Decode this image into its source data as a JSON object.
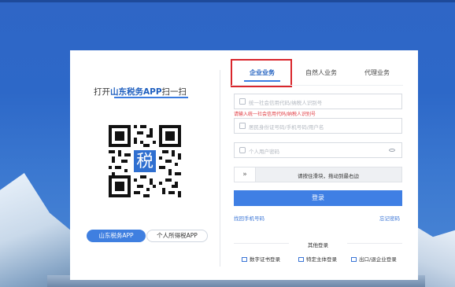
{
  "left_panel": {
    "title_prefix": "打开",
    "title_highlight": "山东税务APP",
    "title_suffix": "扫一扫",
    "qr_center_char": "税",
    "app_button_primary": "山东税务APP",
    "app_button_secondary": "个人所得税APP"
  },
  "tabs": [
    {
      "label": "企业业务",
      "active": true
    },
    {
      "label": "自然人业务",
      "active": false
    },
    {
      "label": "代理业务",
      "active": false
    }
  ],
  "form": {
    "credit_code_placeholder": "统一社会信用代码/纳税人识别号",
    "credit_code_error": "请输入统一社会信用代码/纳税人识别号",
    "account_placeholder": "居民身份证号码/手机号码/用户名",
    "password_placeholder": "个人用户密码",
    "slider_text": "请按住滑块，拖动到最右边",
    "slider_handle": "»",
    "login_button": "登录",
    "register_link": "找回手机号码",
    "forgot_link": "忘记密码"
  },
  "other_login": {
    "title": "其他登录",
    "options": [
      "数字证书登录",
      "特定主体登录",
      "出口/退企业登录"
    ]
  },
  "colors": {
    "accent": "#3f7fe4",
    "error": "#e0383e",
    "highlight_box": "#d9262c"
  }
}
